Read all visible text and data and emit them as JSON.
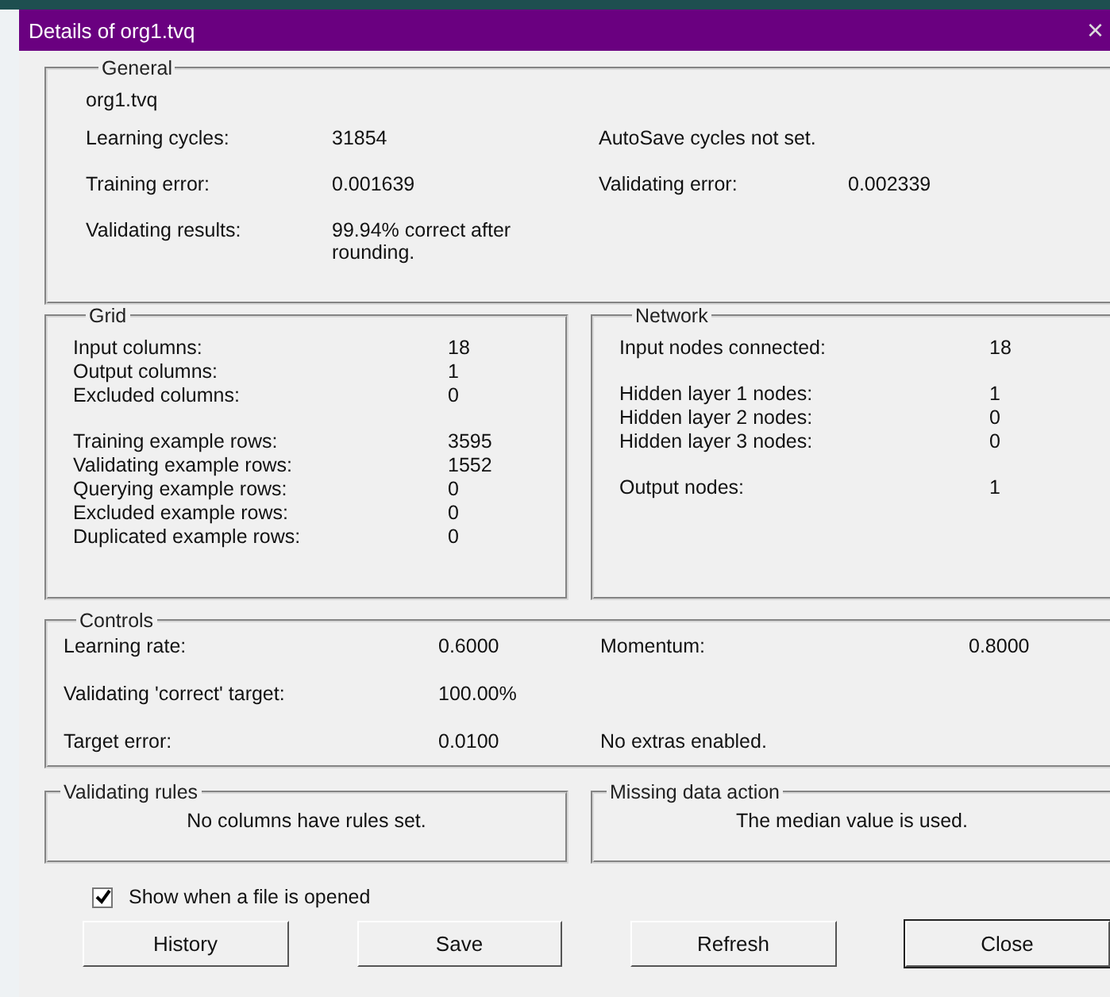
{
  "window": {
    "title": "Details of org1.tvq",
    "close": "×"
  },
  "general": {
    "title": "General",
    "filename": "org1.tvq",
    "rows": [
      {
        "label": "Learning cycles:",
        "value": "31854",
        "label2": "AutoSave cycles not set."
      },
      {
        "label": "Training error:",
        "value": "0.001639",
        "label2": "Validating error:",
        "value2": "0.002339"
      },
      {
        "label": "Validating results:",
        "value": "99.94% correct after rounding."
      }
    ]
  },
  "grid": {
    "title": "Grid",
    "groups": [
      [
        {
          "label": "Input columns:",
          "value": "18"
        },
        {
          "label": "Output columns:",
          "value": "1"
        },
        {
          "label": "Excluded columns:",
          "value": "0"
        }
      ],
      [
        {
          "label": "Training example rows:",
          "value": "3595"
        },
        {
          "label": "Validating example rows:",
          "value": "1552"
        },
        {
          "label": "Querying example rows:",
          "value": "0"
        },
        {
          "label": "Excluded example rows:",
          "value": "0"
        },
        {
          "label": "Duplicated example rows:",
          "value": "0"
        }
      ]
    ]
  },
  "network": {
    "title": "Network",
    "groups": [
      [
        {
          "label": "Input nodes connected:",
          "value": "18"
        }
      ],
      [
        {
          "label": "Hidden layer 1 nodes:",
          "value": "1"
        },
        {
          "label": "Hidden layer 2 nodes:",
          "value": "0"
        },
        {
          "label": "Hidden layer 3 nodes:",
          "value": "0"
        }
      ],
      [
        {
          "label": "Output nodes:",
          "value": "1"
        }
      ]
    ]
  },
  "controls": {
    "title": "Controls",
    "rows": [
      {
        "label": "Learning rate:",
        "value": "0.6000",
        "label2": "Momentum:",
        "value2": "0.8000"
      },
      {
        "label": "Validating 'correct' target:",
        "value": "100.00%"
      },
      {
        "label": "Target error:",
        "value": "0.0100",
        "label2": "No extras enabled."
      }
    ]
  },
  "validating_rules": {
    "title": "Validating rules",
    "text": "No columns have rules set."
  },
  "missing_data": {
    "title": "Missing data action",
    "text": "The median value is used."
  },
  "show_on_open": {
    "label": "Show when a file is opened",
    "checked": true
  },
  "buttons": [
    {
      "label": "History",
      "default": false
    },
    {
      "label": "Save",
      "default": false
    },
    {
      "label": "Refresh",
      "default": false
    },
    {
      "label": "Close",
      "default": true
    }
  ]
}
